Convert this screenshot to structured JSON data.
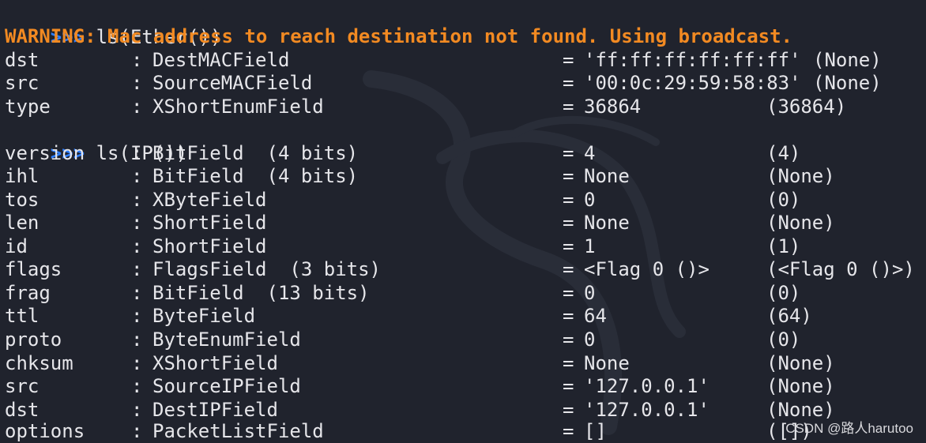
{
  "colors": {
    "background": "#20232d",
    "text": "#e6e6ea",
    "prompt": "#2f7fff",
    "warning": "#f28a22"
  },
  "background_icon": "kali-dragon-logo-watermark",
  "prompt_symbol": ">>>",
  "commands": {
    "ether": "ls(Ether())",
    "ip": "ls(IP())"
  },
  "warning": "WARNING: Mac address to reach destination not found. Using broadcast.",
  "ether_fields": [
    {
      "name": "dst",
      "type": "DestMACField",
      "value": "'ff:ff:ff:ff:ff:ff'",
      "default": "(None)"
    },
    {
      "name": "src",
      "type": "SourceMACField",
      "value": "'00:0c:29:59:58:83'",
      "default": "(None)"
    },
    {
      "name": "type",
      "type": "XShortEnumField",
      "value": "36864",
      "default": "(36864)"
    }
  ],
  "ip_fields": [
    {
      "name": "version",
      "type": "BitField  (4 bits)",
      "value": "4",
      "default": "(4)"
    },
    {
      "name": "ihl",
      "type": "BitField  (4 bits)",
      "value": "None",
      "default": "(None)"
    },
    {
      "name": "tos",
      "type": "XByteField",
      "value": "0",
      "default": "(0)"
    },
    {
      "name": "len",
      "type": "ShortField",
      "value": "None",
      "default": "(None)"
    },
    {
      "name": "id",
      "type": "ShortField",
      "value": "1",
      "default": "(1)"
    },
    {
      "name": "flags",
      "type": "FlagsField  (3 bits)",
      "value": "<Flag 0 ()>",
      "default": "(<Flag 0 ()>)"
    },
    {
      "name": "frag",
      "type": "BitField  (13 bits)",
      "value": "0",
      "default": "(0)"
    },
    {
      "name": "ttl",
      "type": "ByteField",
      "value": "64",
      "default": "(64)"
    },
    {
      "name": "proto",
      "type": "ByteEnumField",
      "value": "0",
      "default": "(0)"
    },
    {
      "name": "chksum",
      "type": "XShortField",
      "value": "None",
      "default": "(None)"
    },
    {
      "name": "src",
      "type": "SourceIPField",
      "value": "'127.0.0.1'",
      "default": "(None)"
    },
    {
      "name": "dst",
      "type": "DestIPField",
      "value": "'127.0.0.1'",
      "default": "(None)"
    },
    {
      "name": "options",
      "type": "PacketListField",
      "value": "[]",
      "default": "([])"
    }
  ],
  "separators": {
    "colon": ":",
    "equals": "="
  },
  "watermark": "CSDN @路人harutoo"
}
